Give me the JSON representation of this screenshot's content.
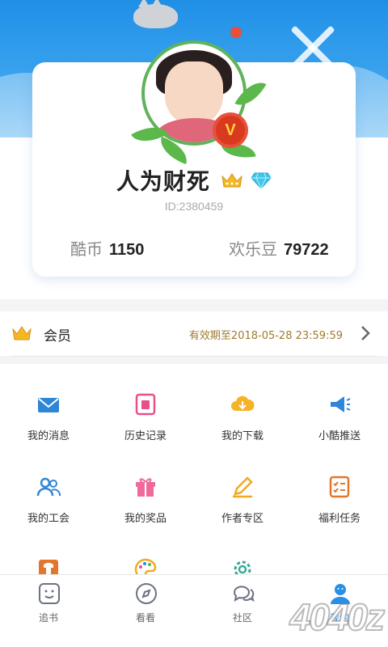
{
  "profile": {
    "username": "人为财死",
    "id_text": "ID:2380459",
    "coins_label": "酷币",
    "coins_value": "1150",
    "beans_label": "欢乐豆",
    "beans_value": "79722",
    "vip_badge": "V"
  },
  "membership": {
    "label": "会员",
    "expiry": "有效期至2018-05-28 23:59:59"
  },
  "menu": [
    {
      "label": "我的消息",
      "icon": "envelope-icon"
    },
    {
      "label": "历史记录",
      "icon": "history-icon"
    },
    {
      "label": "我的下载",
      "icon": "cloud-download-icon"
    },
    {
      "label": "小酷推送",
      "icon": "megaphone-icon"
    },
    {
      "label": "我的工会",
      "icon": "group-icon"
    },
    {
      "label": "我的奖品",
      "icon": "gift-icon"
    },
    {
      "label": "作者专区",
      "icon": "pencil-icon"
    },
    {
      "label": "福利任务",
      "icon": "checklist-icon"
    }
  ],
  "nav": [
    {
      "label": "追书",
      "icon": "smiley-icon"
    },
    {
      "label": "看看",
      "icon": "compass-icon"
    },
    {
      "label": "社区",
      "icon": "chat-icon"
    },
    {
      "label": "我的",
      "icon": "person-icon",
      "active": true
    }
  ],
  "watermark": "4040z",
  "colors": {
    "accent": "#2a8fe6",
    "gold": "#a07b2c",
    "vip_red": "#d9391f"
  }
}
